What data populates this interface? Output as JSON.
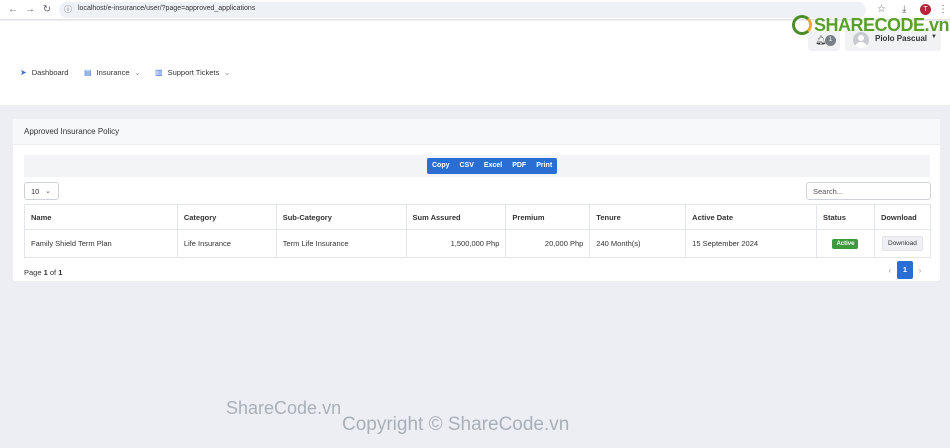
{
  "browser": {
    "back": "←",
    "forward": "→",
    "reload": "↻",
    "url": "localhost/e-insurance/user/?page=approved_applications",
    "profile_initial": "T"
  },
  "watermark": {
    "logo_main": "SHARECODE",
    "logo_suffix": ".vn",
    "mid_text": "ShareCode.vn",
    "bottom_text": "Copyright © ShareCode.vn"
  },
  "header": {
    "notification_count": "1",
    "user_name": "Piolo Pascual"
  },
  "nav": {
    "items": [
      {
        "label": "Dashboard",
        "icon": "paper-plane-icon"
      },
      {
        "label": "Insurance",
        "icon": "book-icon"
      },
      {
        "label": "Support Tickets",
        "icon": "document-icon"
      }
    ]
  },
  "card": {
    "title": "Approved Insurance Policy"
  },
  "export_buttons": [
    "Copy",
    "CSV",
    "Excel",
    "PDF",
    "Print"
  ],
  "table_controls": {
    "page_length": "10",
    "search_placeholder": "Search..."
  },
  "table": {
    "columns": [
      "Name",
      "Category",
      "Sub-Category",
      "Sum Assured",
      "Premium",
      "Tenure",
      "Active Date",
      "Status",
      "Download"
    ],
    "rows": [
      {
        "name": "Family Shield Term Plan",
        "category": "Life Insurance",
        "sub_category": "Term Life Insurance",
        "sum_assured": "1,500,000 Php",
        "premium": "20,000 Php",
        "tenure": "240 Month(s)",
        "active_date": "15 September 2024",
        "status": "Active",
        "download": "Download"
      }
    ]
  },
  "pagination": {
    "page_word": "Page",
    "current": "1",
    "of_word": "of",
    "total": "1",
    "prev": "‹",
    "next": "›"
  },
  "colors": {
    "primary": "#2a6ed3",
    "status_active": "#3d9a3d",
    "background": "#eceef4"
  }
}
